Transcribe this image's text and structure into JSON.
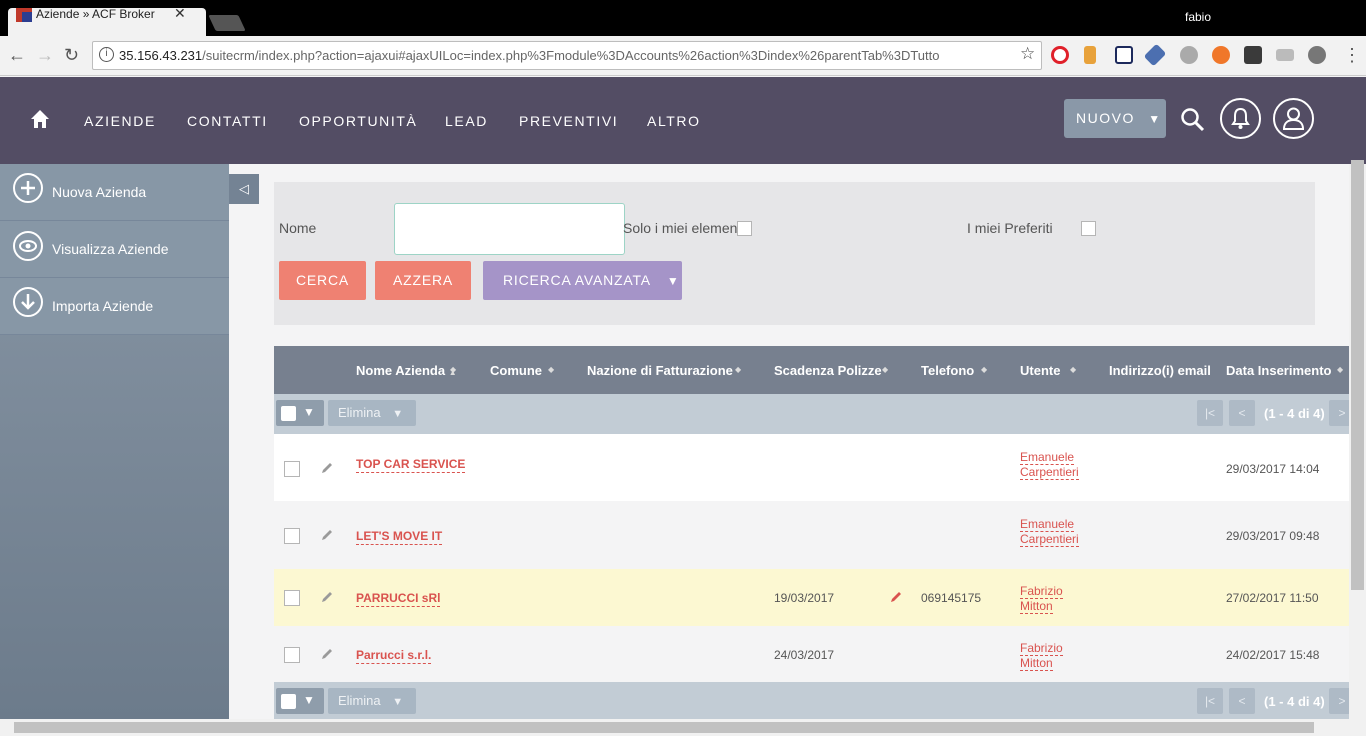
{
  "browser": {
    "tab_title": "Aziende » ACF Broker",
    "user": "fabio",
    "url_host": "35.156.43.231",
    "url_path": "/suitecrm/index.php?action=ajaxui#ajaxUILoc=index.php%3Fmodule%3DAccounts%26action%3Dindex%26parentTab%3DTutto"
  },
  "nav": {
    "items": [
      "AZIENDE",
      "CONTATTI",
      "OPPORTUNITÀ",
      "LEAD",
      "PREVENTIVI",
      "ALTRO"
    ],
    "new_button": "NUOVO"
  },
  "sidebar": {
    "items": [
      "Nuova Azienda",
      "Visualizza Aziende",
      "Importa Aziende"
    ]
  },
  "search": {
    "name_label": "Nome",
    "only_mine_label": "Solo i miei elementi",
    "favorites_label": "I miei Preferiti",
    "search_button": "CERCA",
    "reset_button": "AZZERA",
    "advanced_button": "RICERCA AVANZATA"
  },
  "table": {
    "columns": [
      "Nome Azienda",
      "Comune",
      "Nazione di Fatturazione",
      "Scadenza Polizze",
      "Telefono",
      "Utente",
      "Indirizzo(i) email",
      "Data Inserimento"
    ],
    "bulk_delete": "Elimina",
    "pagination": "(1 - 4 di 4)",
    "rows": [
      {
        "name": "TOP CAR SERVICE",
        "expiry": "",
        "phone": "",
        "user_first": "Emanuele",
        "user_last": "Carpentieri",
        "date": "29/03/2017 14:04"
      },
      {
        "name": "LET'S MOVE IT",
        "expiry": "",
        "phone": "",
        "user_first": "Emanuele",
        "user_last": "Carpentieri",
        "date": "29/03/2017 09:48"
      },
      {
        "name": "PARRUCCI sRl",
        "expiry": "19/03/2017",
        "phone": "069145175",
        "user_first": "Fabrizio",
        "user_last": "Mitton",
        "date": "27/02/2017 11:50"
      },
      {
        "name": "Parrucci s.r.l.",
        "expiry": "24/03/2017",
        "phone": "",
        "user_first": "Fabrizio",
        "user_last": "Mitton",
        "date": "24/02/2017 15:48"
      }
    ]
  },
  "colors": {
    "header_bg": "#534d64",
    "accent_red": "#d9534f",
    "button_salmon": "#ef8172",
    "button_purple": "#a594c8",
    "highlight_row": "#fcf8d2"
  }
}
